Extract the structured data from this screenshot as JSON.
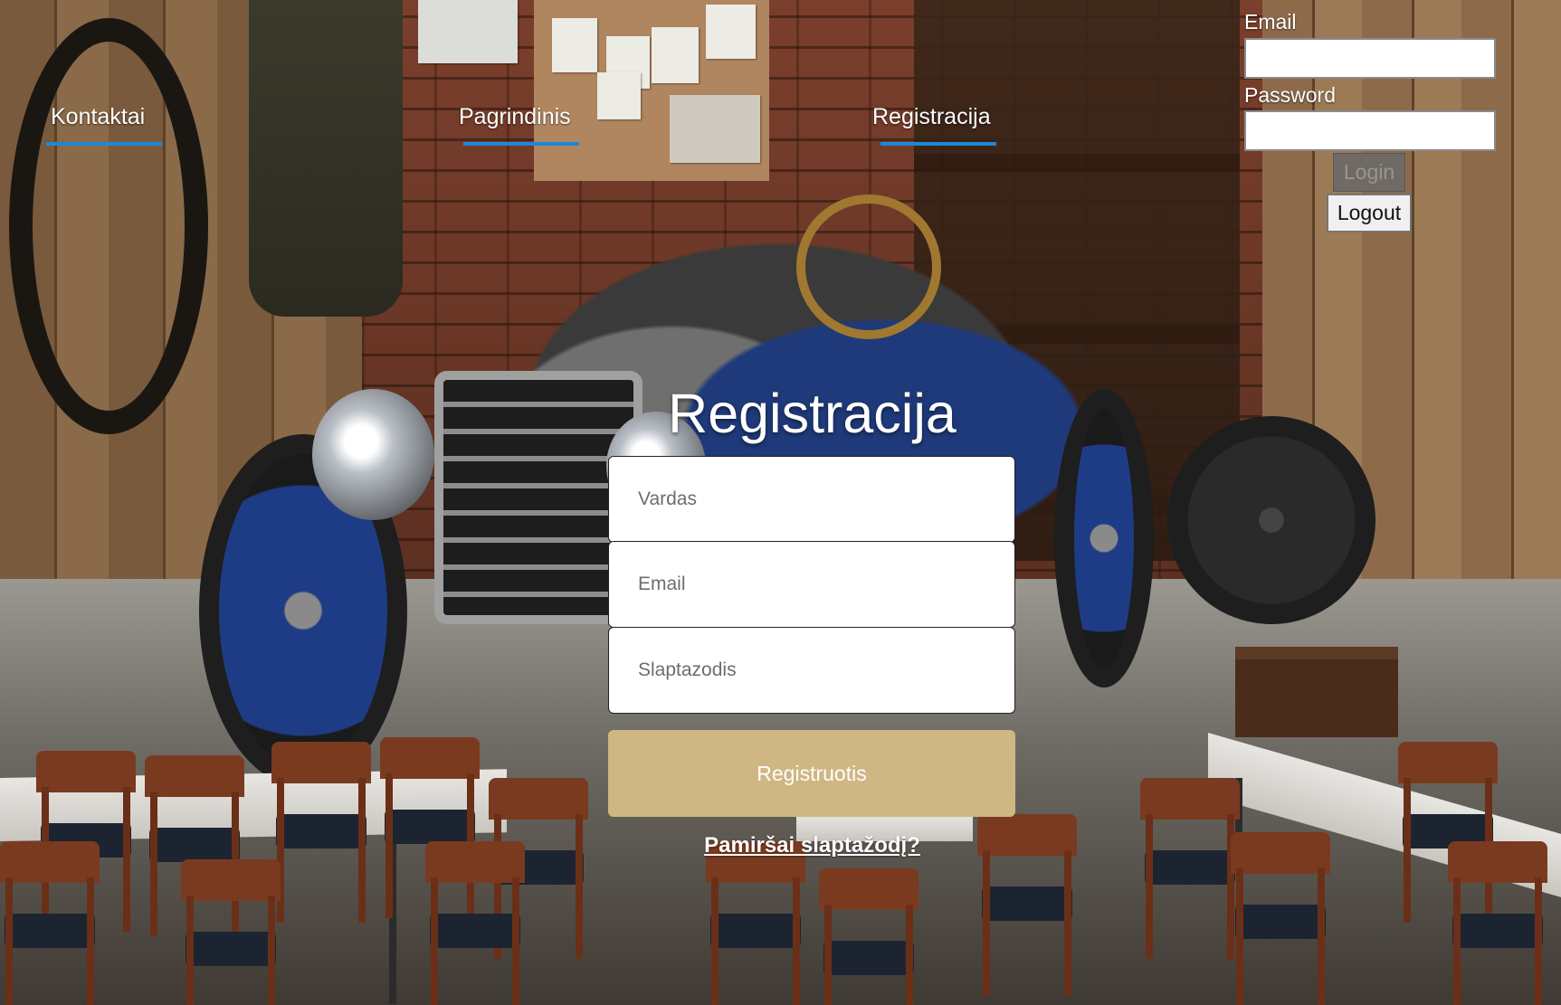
{
  "nav": {
    "links": [
      {
        "label": "Kontaktai"
      },
      {
        "label": "Pagrindinis"
      },
      {
        "label": "Registracija"
      }
    ],
    "underline_color": "#1e88d6"
  },
  "login": {
    "email_label": "Email",
    "email_value": "",
    "password_label": "Password",
    "password_value": "",
    "login_button": "Login",
    "logout_button": "Logout"
  },
  "registration": {
    "title": "Registracija",
    "fields": [
      {
        "placeholder": "Vardas"
      },
      {
        "placeholder": "Email"
      },
      {
        "placeholder": "Slaptazodis"
      }
    ],
    "submit_label": "Registruotis",
    "submit_color": "#cfb784",
    "forgot_link": "Pamiršai slaptažodį?"
  },
  "background": {
    "scene": "photo-background"
  }
}
